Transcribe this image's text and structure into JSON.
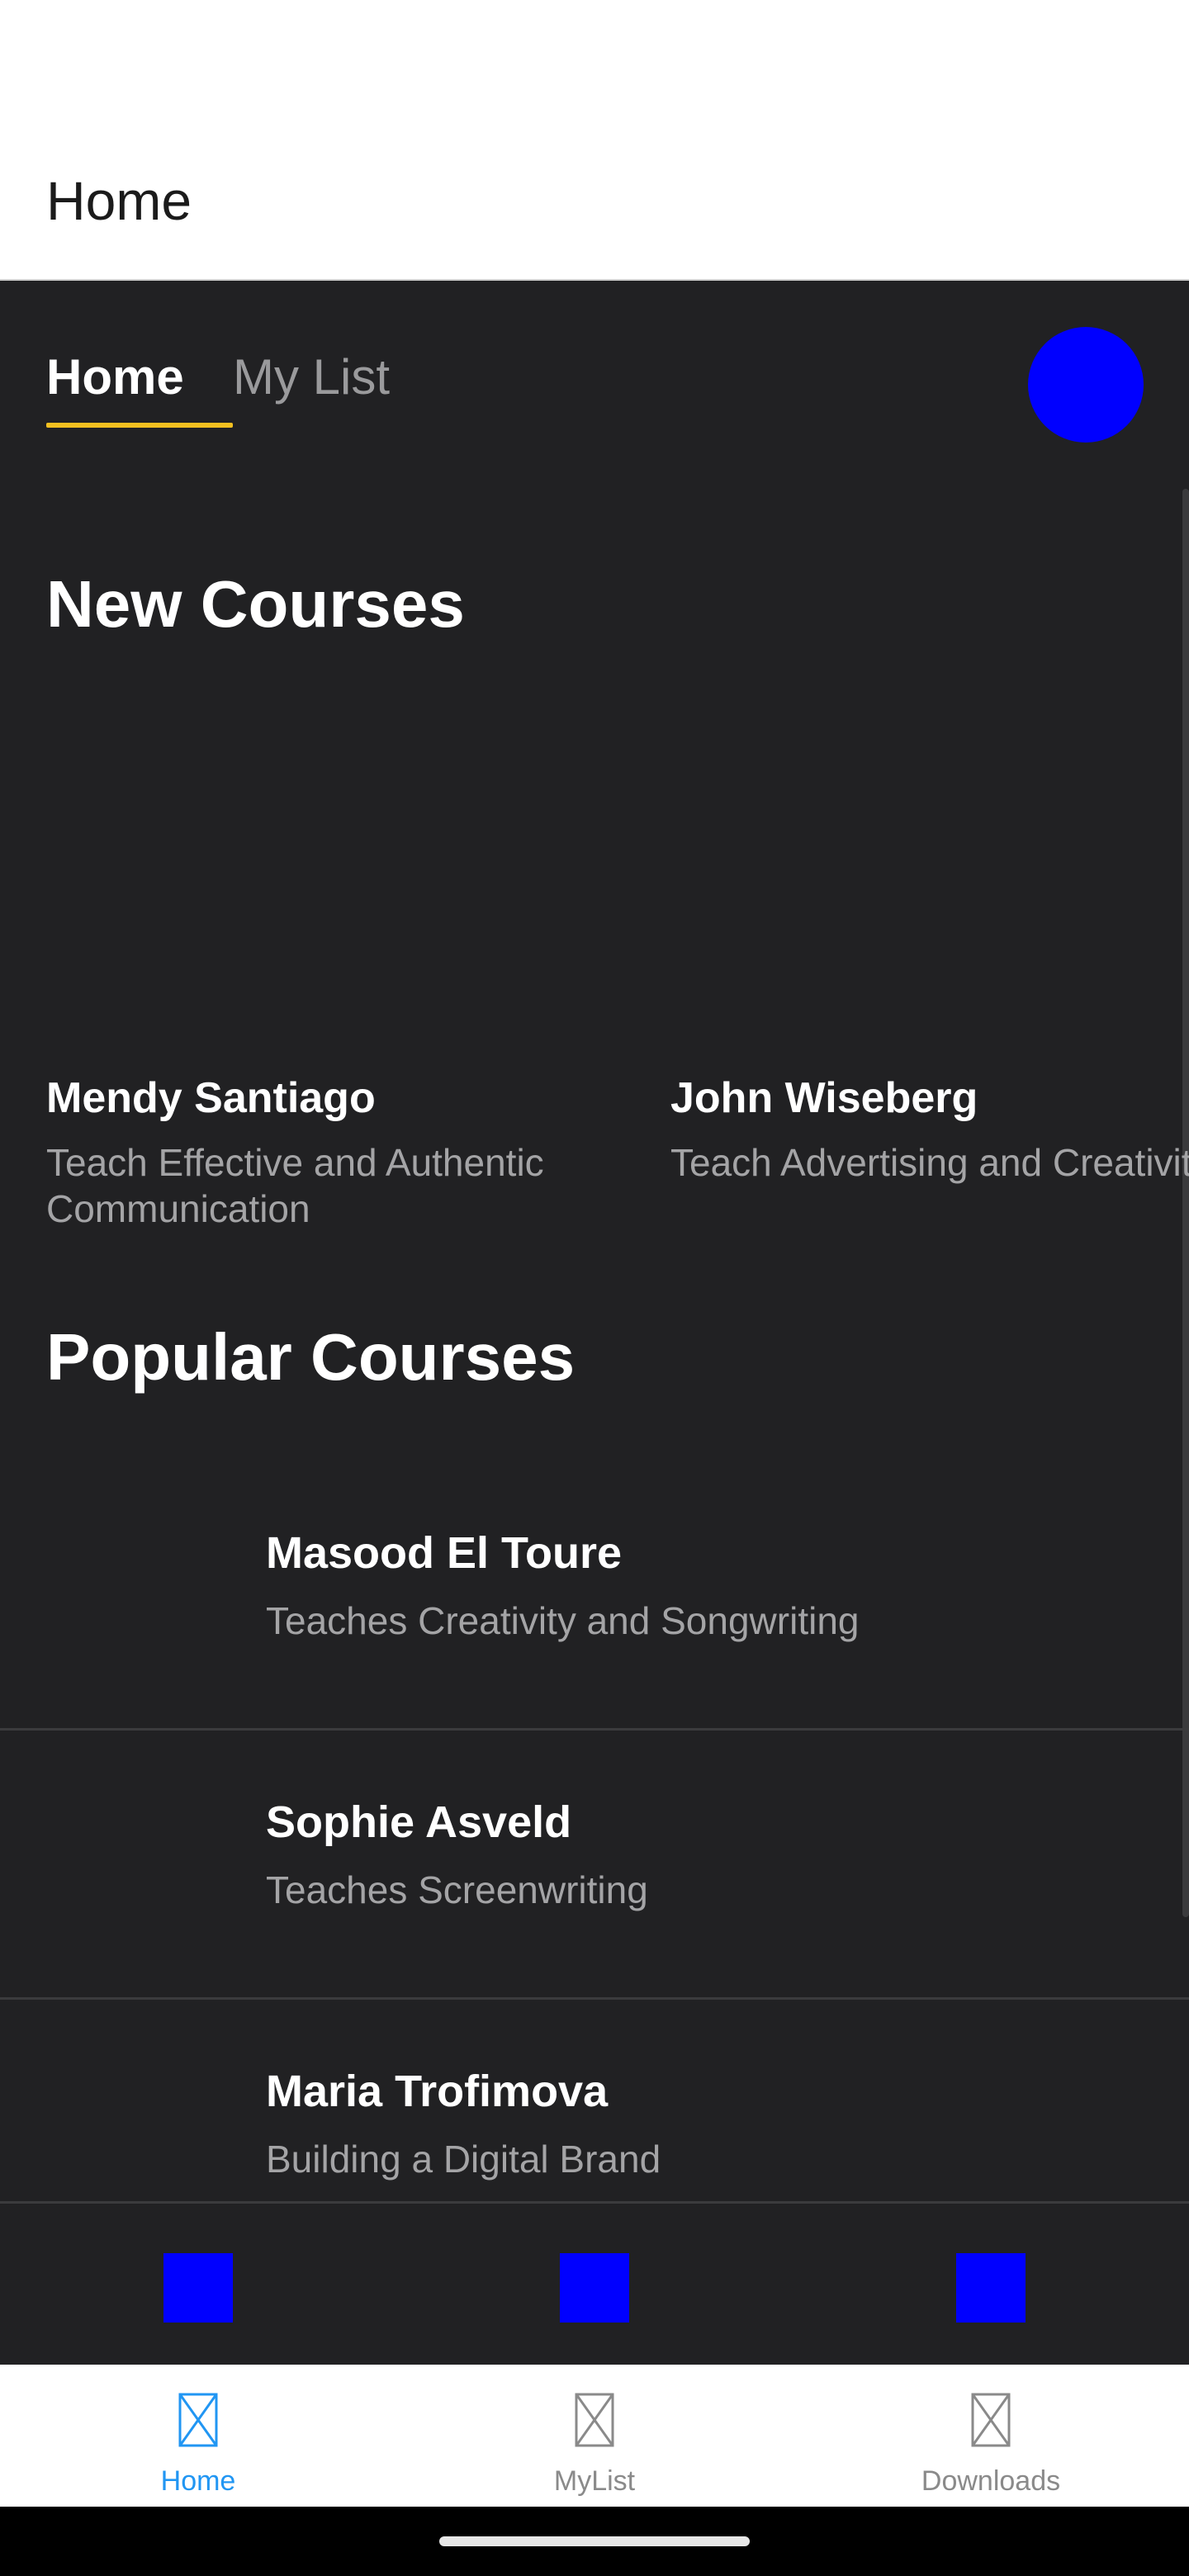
{
  "app_bar": {
    "title": "Home"
  },
  "tabs": [
    {
      "label": "Home",
      "active": true
    },
    {
      "label": "My List",
      "active": false
    }
  ],
  "colors": {
    "tab_indicator": "#f3c020",
    "placeholder_blue": "#0000ff",
    "nav_active": "#2196f3",
    "nav_inactive": "#8a8a8a",
    "content_bg": "#212123"
  },
  "avatar": {
    "icon": "profile-avatar"
  },
  "new_courses": {
    "title": "New Courses",
    "items": [
      {
        "name": "Mendy Santiago",
        "description": "Teach Effective and Authentic Communication"
      },
      {
        "name": "John Wiseberg",
        "description": "Teach Advertising and Creativity"
      }
    ]
  },
  "popular_courses": {
    "title": "Popular Courses",
    "items": [
      {
        "name": "Masood El Toure",
        "description": "Teaches Creativity and Songwriting"
      },
      {
        "name": "Sophie Asveld",
        "description": "Teaches Screenwriting"
      },
      {
        "name": "Maria Trofimova",
        "description": "Building a Digital Brand"
      }
    ]
  },
  "action_bar": {
    "buttons": [
      "action-1",
      "action-2",
      "action-3"
    ]
  },
  "bottom_nav": {
    "items": [
      {
        "label": "Home",
        "icon": "home-icon",
        "active": true
      },
      {
        "label": "MyList",
        "icon": "mylist-icon",
        "active": false
      },
      {
        "label": "Downloads",
        "icon": "downloads-icon",
        "active": false
      }
    ]
  }
}
